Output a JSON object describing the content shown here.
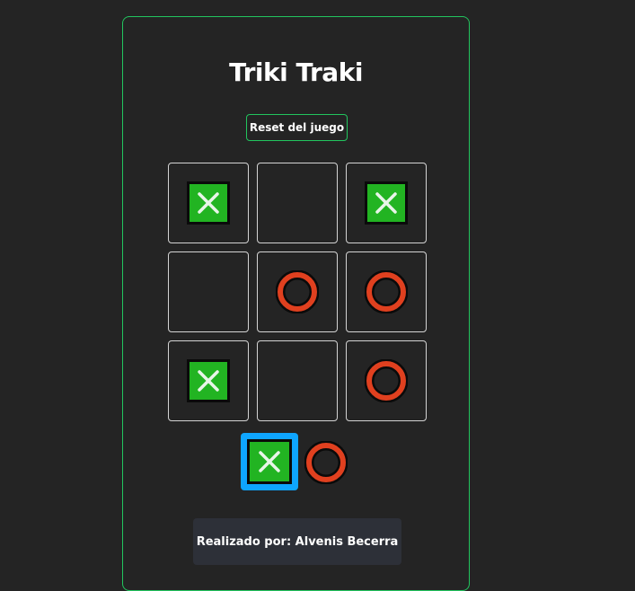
{
  "title": "Triki Traki",
  "reset_label": "Reset del juego",
  "board": {
    "cells": [
      "X",
      "",
      "X",
      "",
      "O",
      "O",
      "X",
      "",
      "O"
    ]
  },
  "turn": {
    "current": "X",
    "symbols": [
      "X",
      "O"
    ]
  },
  "footer_text": "Realizado por: Alvenis Becerra",
  "colors": {
    "background": "#242424",
    "panel_border": "#22c55e",
    "x_fill": "#22b422",
    "o_stroke": "#e0401f",
    "active_turn": "#0ea5ff",
    "footer_bg": "#2d3038"
  },
  "icons": {
    "x": "x-mark-icon",
    "o": "o-mark-icon"
  }
}
